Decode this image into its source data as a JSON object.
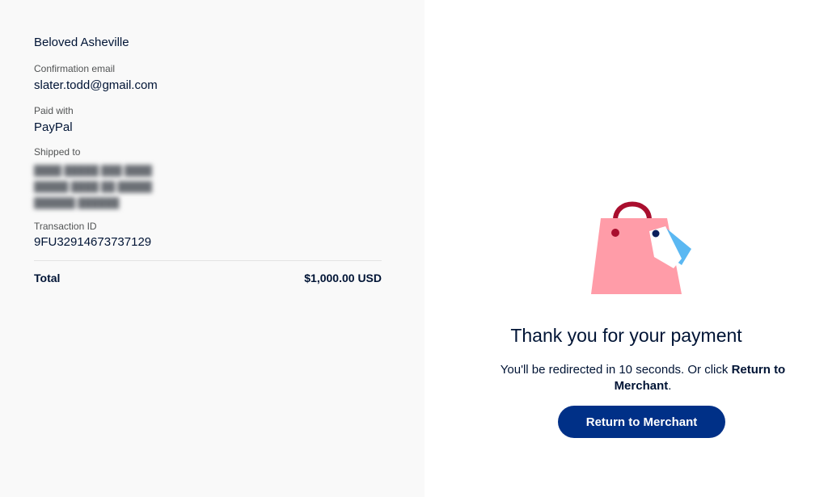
{
  "summary": {
    "merchant_name": "Beloved Asheville",
    "confirmation_email_label": "Confirmation email",
    "confirmation_email": "slater.todd@gmail.com",
    "paid_with_label": "Paid with",
    "paid_with": "PayPal",
    "shipped_to_label": "Shipped to",
    "transaction_id_label": "Transaction ID",
    "transaction_id": "9FU32914673737129",
    "total_label": "Total",
    "total_value": "$1,000.00 USD"
  },
  "confirmation": {
    "title": "Thank you for your payment",
    "redirect_text": "You'll be redirected in 10 seconds. Or click ",
    "redirect_link_text": "Return to Merchant",
    "redirect_end": ".",
    "button_label": "Return to Merchant"
  },
  "colors": {
    "button_bg": "#003087",
    "left_panel_bg": "#f9f9f9",
    "text": "#001435",
    "bag_pink": "#ff9ca8",
    "bag_handle": "#a90e2e",
    "tag_blue": "#5bb8f2"
  },
  "icons": {
    "illustration": "shopping-bag-with-tag-icon"
  }
}
